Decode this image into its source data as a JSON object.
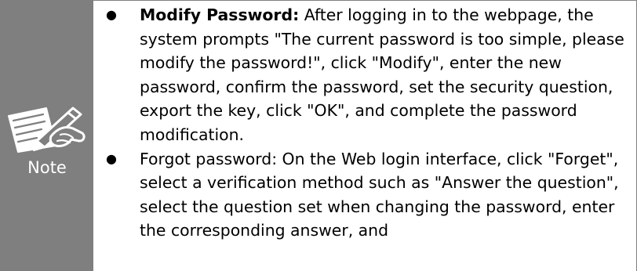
{
  "note": {
    "label": "Note",
    "icon": "note-pencil-icon"
  },
  "bullets": [
    {
      "marker": "●",
      "title": "Modify Password:",
      "text": " After logging in to the webpage, the system prompts \"The current password is too simple, please modify the password!\", click \"Modify\", enter the new password, confirm the password, set the security question, export the key, click \"OK\", and complete the password modification."
    },
    {
      "marker": "●",
      "text": "Forgot password: On the Web login interface, click \"Forget\", select a verification method such as \"Answer the question\", select the question set when changing the password, enter the corresponding answer, and"
    }
  ],
  "colors": {
    "side_panel": "#7f7f7f",
    "label": "#ffffff",
    "text": "#000000"
  }
}
